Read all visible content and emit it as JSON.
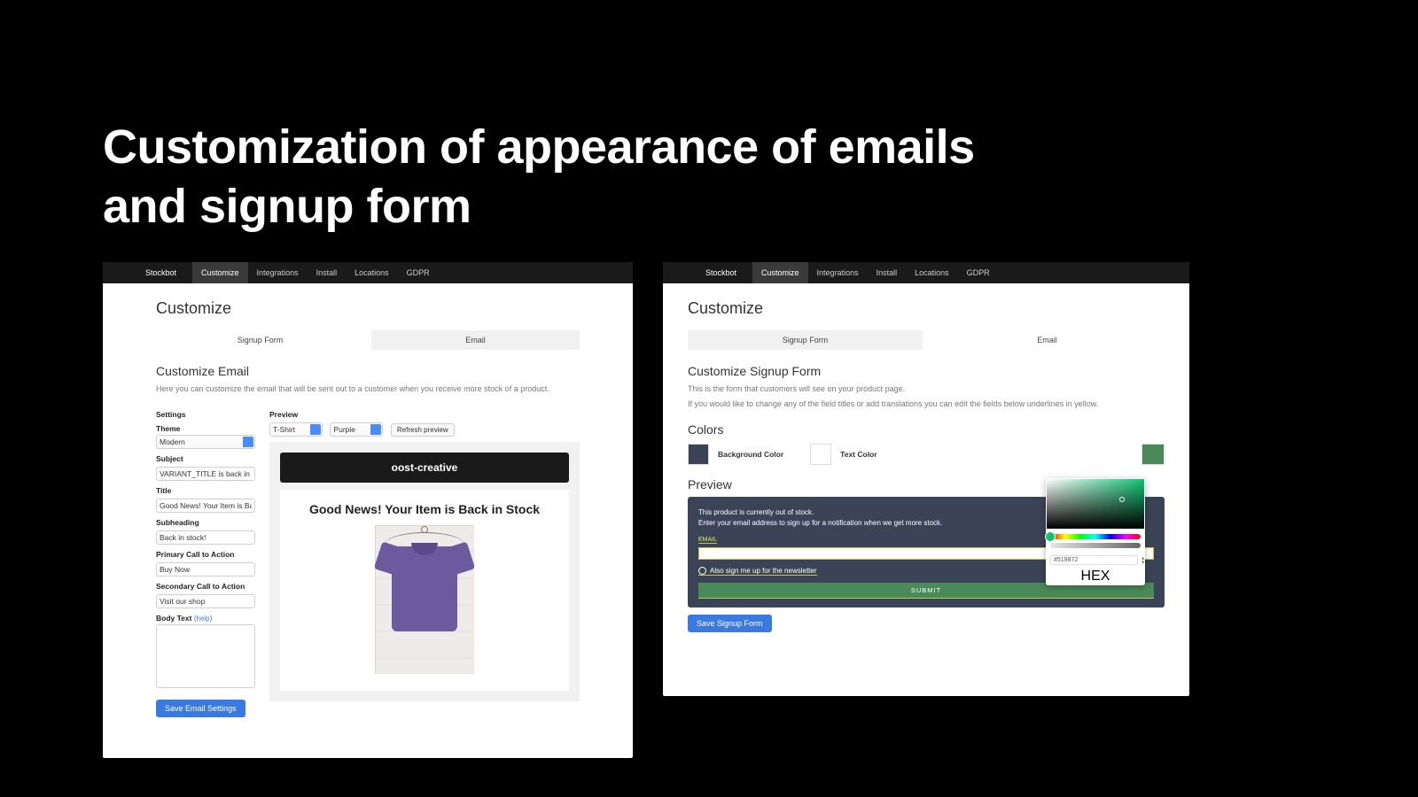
{
  "slide": {
    "line1": "Customization of appearance of emails",
    "line2": "and signup form"
  },
  "nav": {
    "brand": "Stockbot",
    "items": [
      "Customize",
      "Integrations",
      "Install",
      "Locations",
      "GDPR"
    ],
    "active": "Customize"
  },
  "left": {
    "pageTitle": "Customize",
    "tabs": {
      "a": "Signup Form",
      "b": "Email"
    },
    "section": "Customize Email",
    "desc": "Here you can customize the email that will be sent out to a customer when you receive more stock of a product.",
    "settingsHdr": "Settings",
    "previewHdr": "Preview",
    "themeLbl": "Theme",
    "themeVal": "Modern",
    "subjectLbl": "Subject",
    "subjectVal": "VARIANT_TITLE is back in stock",
    "titleLbl": "Title",
    "titleVal": "Good News! Your Item is Back in Stock",
    "subheadLbl": "Subheading",
    "subheadVal": "Back in stock!",
    "ctaLbl": "Primary Call to Action",
    "ctaVal": "Buy Now",
    "cta2Lbl": "Secondary Call to Action",
    "cta2Val": "Visit our shop",
    "bodyLbl": "Body Text",
    "bodyHelp": "(help)",
    "selProduct": "T-Shirt",
    "selVariant": "Purple",
    "refresh": "Refresh preview",
    "brandName": "oost-creative",
    "emailTitle": "Good News! Your Item is Back in Stock",
    "saveBtn": "Save Email Settings"
  },
  "right": {
    "pageTitle": "Customize",
    "tabs": {
      "a": "Signup Form",
      "b": "Email"
    },
    "section": "Customize Signup Form",
    "desc1": "This is the form that customers will see on your product page.",
    "desc2": "If you would like to change any of the field titles or add translations you can edit the fields below underlines in yellow.",
    "colorsHdr": "Colors",
    "bgLbl": "Background Color",
    "txtLbl": "Text Color",
    "bgColor": "#3a4456",
    "txtColor": "#ffffff",
    "previewHdr": "Preview",
    "oos": "This product is currently out of stock.",
    "prompt": "Enter your email address to sign up for a notification when we get more stock.",
    "emailLbl": "EMAIL",
    "newsletter": "Also sign me up for the newsletter",
    "submit": "SUBMIT",
    "saveBtn": "Save Signup Form",
    "picker": {
      "pickedHex": "#519872",
      "pickedColor": "#0fc472",
      "hexLabel": "HEX"
    }
  }
}
